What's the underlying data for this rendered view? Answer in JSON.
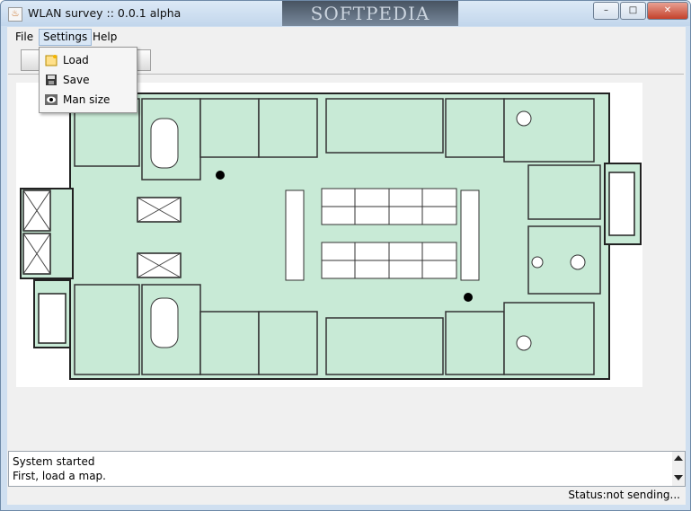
{
  "window": {
    "title": "WLAN survey :: 0.0.1 alpha",
    "watermark": "SOFTPEDIA",
    "app_icon_glyph": "♨",
    "controls": {
      "minimize": "–",
      "maximize": "□",
      "close": "✕"
    }
  },
  "menubar": {
    "items": [
      "File",
      "Settings",
      "Help"
    ],
    "open_menu": "Settings"
  },
  "settings_menu": {
    "items": [
      {
        "label": "Load",
        "icon": "load-icon"
      },
      {
        "label": "Save",
        "icon": "save-icon"
      },
      {
        "label": "Man size",
        "icon": "eye-icon"
      }
    ]
  },
  "map": {
    "description_icon": "floor-plan",
    "measure_points": 2,
    "floor_color": "#c8ead6",
    "wall_color": "#222222"
  },
  "log": {
    "lines": [
      "System started",
      "First, load a map."
    ]
  },
  "statusbar": {
    "status": "Status:not sending..."
  }
}
